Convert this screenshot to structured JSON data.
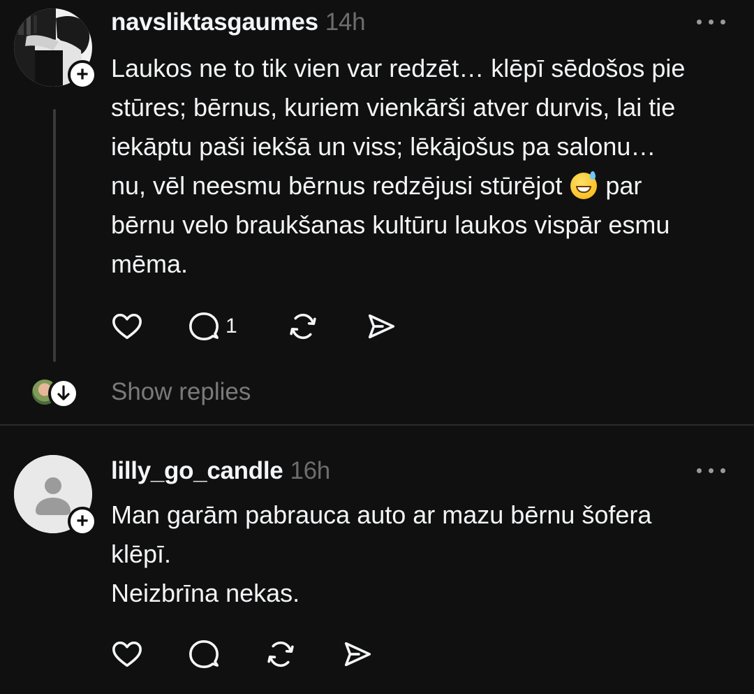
{
  "posts": [
    {
      "username": "navsliktasgaumes",
      "time": "14h",
      "text_lines": [
        "Laukos ne to tik vien var redzēt… klēpī sēdošos pie",
        "stūres; bērnus, kuriem vienkārši atver durvis, lai tie",
        "iekāptu paši iekšā un viss; lēkājošus pa salonu…",
        "nu, vēl neesmu bērnus redzējusi stūrējot",
        "par",
        "bērnu velo braukšanas kultūru laukos vispār esmu",
        "mēma."
      ],
      "emoji_icon": "grinning-face-with-sweat-icon",
      "actions": {
        "like_icon": "heart-icon",
        "reply_icon": "comment-icon",
        "reply_count": "1",
        "repost_icon": "repost-icon",
        "share_icon": "send-icon"
      },
      "show_replies": "Show replies"
    },
    {
      "username": "lilly_go_candle",
      "time": "16h",
      "text_lines": [
        "Man garām pabrauca auto ar mazu bērnu šofera",
        "klēpī.",
        "Neizbrīna nekas."
      ],
      "actions": {
        "like_icon": "heart-icon",
        "reply_icon": "comment-icon",
        "repost_icon": "repost-icon",
        "share_icon": "send-icon"
      }
    }
  ],
  "follow_symbol": "+",
  "colors": {
    "background": "#101010",
    "text": "#f3f5f7",
    "muted": "#6d6d6d",
    "divider": "#2b2b2b"
  }
}
